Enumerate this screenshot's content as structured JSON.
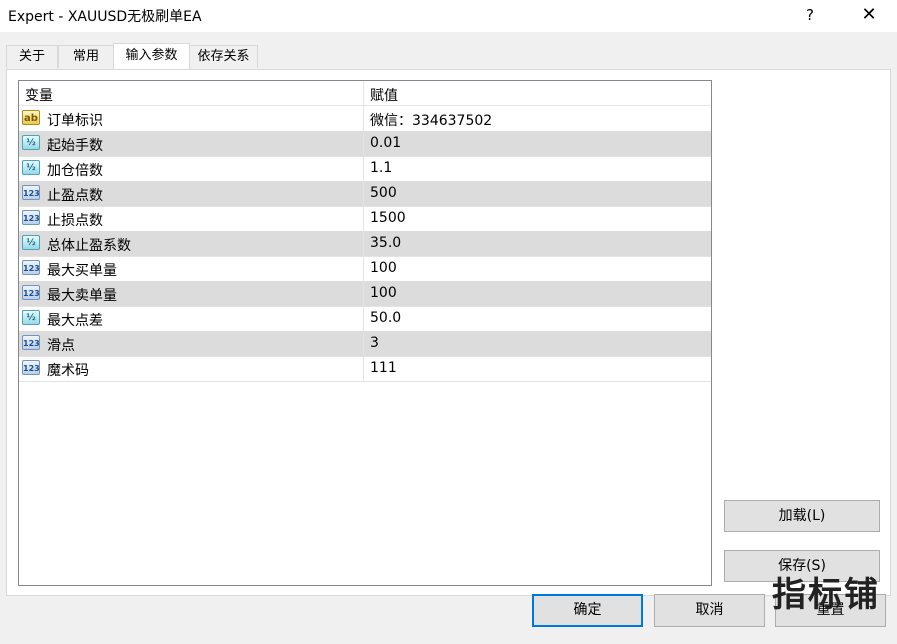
{
  "window": {
    "title": "Expert - XAUUSD无极刷单EA",
    "help_label": "?",
    "close_label": "✕"
  },
  "tabs": [
    {
      "label": "关于"
    },
    {
      "label": "常用"
    },
    {
      "label": "输入参数"
    },
    {
      "label": "依存关系"
    }
  ],
  "active_tab": "输入参数",
  "grid": {
    "headers": {
      "variable": "变量",
      "value": "赋值"
    },
    "rows": [
      {
        "icon": "ab",
        "name": "订单标识",
        "value": "微信：334637502"
      },
      {
        "icon": "½",
        "name": "起始手数",
        "value": "0.01"
      },
      {
        "icon": "½",
        "name": "加仓倍数",
        "value": "1.1"
      },
      {
        "icon": "123",
        "name": "止盈点数",
        "value": "500"
      },
      {
        "icon": "123",
        "name": "止损点数",
        "value": "1500"
      },
      {
        "icon": "½",
        "name": "总体止盈系数",
        "value": "35.0"
      },
      {
        "icon": "123",
        "name": "最大买单量",
        "value": "100"
      },
      {
        "icon": "123",
        "name": "最大卖单量",
        "value": "100"
      },
      {
        "icon": "½",
        "name": "最大点差",
        "value": "50.0"
      },
      {
        "icon": "123",
        "name": "滑点",
        "value": "3"
      },
      {
        "icon": "123",
        "name": "魔术码",
        "value": "111"
      }
    ]
  },
  "side_buttons": {
    "load": "加载(L)",
    "save": "保存(S)"
  },
  "footer_buttons": {
    "ok": "确定",
    "cancel": "取消",
    "reset": "重置"
  },
  "watermark": "指标铺",
  "colors": {
    "accent": "#0078d7",
    "alt_row": "#dcdcdc",
    "dialog_bg": "#f0f0f0"
  }
}
